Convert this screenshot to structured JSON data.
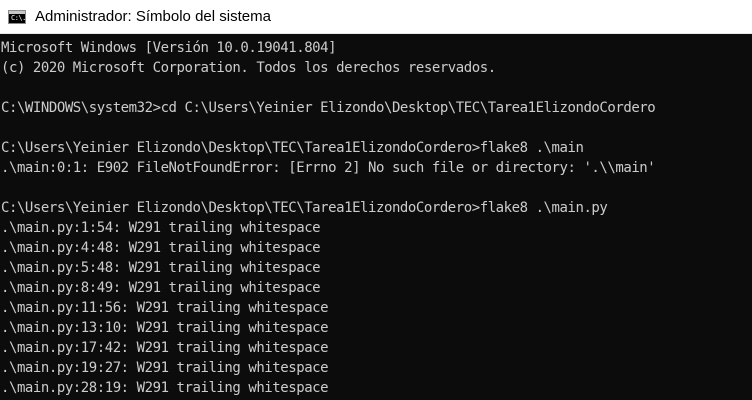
{
  "window": {
    "title": "Administrador: Símbolo del sistema",
    "icon": "cmd-icon",
    "icon_glyph": "C:\\."
  },
  "console": {
    "background": "#0c0c0c",
    "foreground": "#cccccc",
    "lines": [
      "Microsoft Windows [Versión 10.0.19041.804]",
      "(c) 2020 Microsoft Corporation. Todos los derechos reservados.",
      "",
      "C:\\WINDOWS\\system32>cd C:\\Users\\Yeinier Elizondo\\Desktop\\TEC\\Tarea1ElizondoCordero",
      "",
      "C:\\Users\\Yeinier Elizondo\\Desktop\\TEC\\Tarea1ElizondoCordero>flake8 .\\main",
      ".\\main:0:1: E902 FileNotFoundError: [Errno 2] No such file or directory: '.\\\\main'",
      "",
      "C:\\Users\\Yeinier Elizondo\\Desktop\\TEC\\Tarea1ElizondoCordero>flake8 .\\main.py",
      ".\\main.py:1:54: W291 trailing whitespace",
      ".\\main.py:4:48: W291 trailing whitespace",
      ".\\main.py:5:48: W291 trailing whitespace",
      ".\\main.py:8:49: W291 trailing whitespace",
      ".\\main.py:11:56: W291 trailing whitespace",
      ".\\main.py:13:10: W291 trailing whitespace",
      ".\\main.py:17:42: W291 trailing whitespace",
      ".\\main.py:19:27: W291 trailing whitespace",
      ".\\main.py:28:19: W291 trailing whitespace"
    ]
  }
}
